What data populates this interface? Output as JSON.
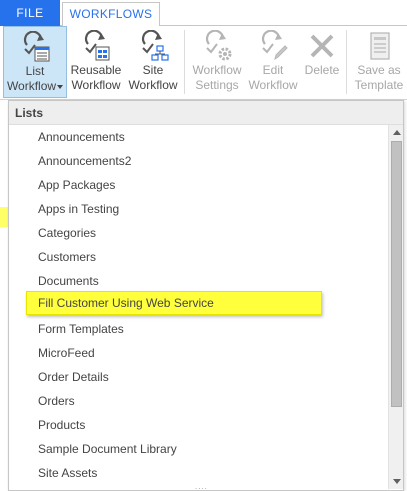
{
  "tabs": {
    "file": "FILE",
    "workflows": "WORKFLOWS"
  },
  "ribbon": {
    "buttons": [
      {
        "line1": "List",
        "line2": "Workflow",
        "icon": "list-workflow-icon",
        "enabled": true,
        "selected": true
      },
      {
        "line1": "Reusable",
        "line2": "Workflow",
        "icon": "reusable-workflow-icon",
        "enabled": true
      },
      {
        "line1": "Site",
        "line2": "Workflow",
        "icon": "site-workflow-icon",
        "enabled": true
      },
      {
        "line1": "Workflow",
        "line2": "Settings",
        "icon": "workflow-settings-icon",
        "enabled": false
      },
      {
        "line1": "Edit",
        "line2": "Workflow",
        "icon": "edit-workflow-icon",
        "enabled": false
      },
      {
        "line1": "Delete",
        "line2": "",
        "icon": "delete-icon",
        "enabled": false
      },
      {
        "line1": "Save as",
        "line2": "Template",
        "icon": "save-as-template-icon",
        "enabled": false
      }
    ]
  },
  "dropdown": {
    "header": "Lists",
    "items": [
      "Announcements",
      "Announcements2",
      "App Packages",
      "Apps in Testing",
      "Categories",
      "Customers",
      "Documents",
      "Fill Customer Using Web Service",
      "Form Templates",
      "MicroFeed",
      "Order Details",
      "Orders",
      "Products",
      "Sample Document Library",
      "Site Assets"
    ],
    "highlighted_item": "Fill Customer Using Web Service",
    "grip": "....",
    "highlight_color": "#ffff3c"
  },
  "colors": {
    "accent": "#2672ec",
    "selected_bg": "#cde6f7",
    "disabled_text": "#a7a7a7"
  }
}
